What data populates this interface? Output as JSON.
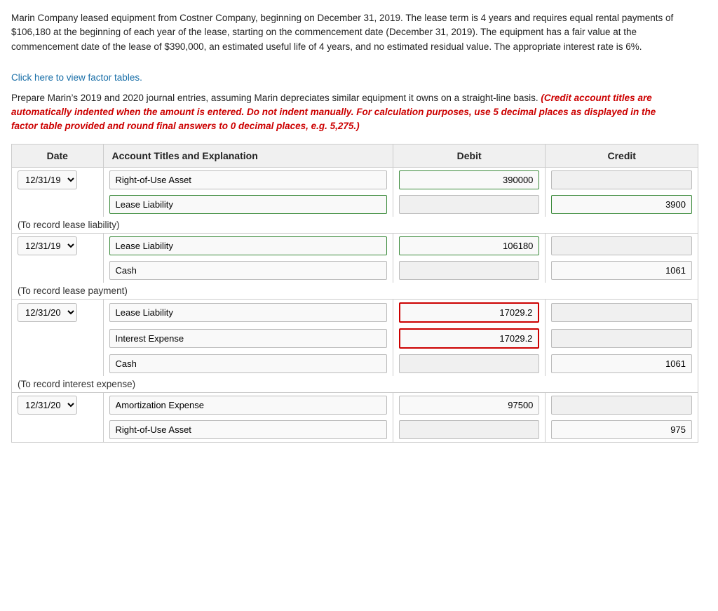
{
  "intro": {
    "text": "Marin Company leased equipment from Costner Company, beginning on December 31, 2019. The lease term is 4 years and requires equal rental payments of $106,180 at the beginning of each year of the lease, starting on the commencement date (December 31, 2019). The equipment has a fair value at the commencement date of the lease of $390,000, an estimated useful life of 4 years, and no estimated residual value. The appropriate interest rate is 6%.",
    "link": "Click here to view factor tables.",
    "prepare_prefix": "Prepare Marin’s 2019 and 2020 journal entries, assuming Marin depreciates similar equipment it owns on a straight-line basis.",
    "prepare_italic": "(Credit account titles are automatically indented when the amount is entered. Do not indent manually. For calculation purposes, use 5 decimal places as displayed in the factor table provided and round final answers to 0 decimal places, e.g. 5,275.)"
  },
  "table": {
    "headers": {
      "date": "Date",
      "account": "Account Titles and Explanation",
      "debit": "Debit",
      "credit": "Credit"
    },
    "sections": [
      {
        "id": "section1",
        "date": "12/31/19",
        "rows": [
          {
            "account": "Right-of-Use Asset",
            "debit": "390000",
            "credit": "",
            "account_style": "normal",
            "debit_style": "green-border",
            "credit_style": "empty"
          },
          {
            "account": "Lease Liability",
            "debit": "",
            "credit": "3900",
            "account_style": "green-border",
            "debit_style": "empty",
            "credit_style": "green-border",
            "credit_overflow": true
          }
        ],
        "note": "(To record lease liability)"
      },
      {
        "id": "section2",
        "date": "12/31/19",
        "rows": [
          {
            "account": "Lease Liability",
            "debit": "106180",
            "credit": "",
            "account_style": "green-border",
            "debit_style": "green-border",
            "credit_style": "empty"
          },
          {
            "account": "Cash",
            "debit": "",
            "credit": "1061",
            "account_style": "normal",
            "debit_style": "empty",
            "credit_style": "normal",
            "credit_overflow": true
          }
        ],
        "note": "(To record lease payment)"
      },
      {
        "id": "section3",
        "date": "12/31/20",
        "rows": [
          {
            "account": "Lease Liability",
            "debit": "17029.2",
            "credit": "",
            "account_style": "normal",
            "debit_style": "red-border",
            "credit_style": "empty"
          },
          {
            "account": "Interest Expense",
            "debit": "17029.2",
            "credit": "",
            "account_style": "normal",
            "debit_style": "red-border",
            "credit_style": "empty"
          },
          {
            "account": "Cash",
            "debit": "",
            "credit": "1061",
            "account_style": "normal",
            "debit_style": "empty",
            "credit_style": "normal",
            "credit_overflow": true
          }
        ],
        "note": "(To record interest expense)"
      },
      {
        "id": "section4",
        "date": "12/31/20",
        "rows": [
          {
            "account": "Amortization Expense",
            "debit": "97500",
            "credit": "",
            "account_style": "normal",
            "debit_style": "normal",
            "credit_style": "empty"
          },
          {
            "account": "Right-of-Use Asset",
            "debit": "",
            "credit": "975",
            "account_style": "normal",
            "debit_style": "empty",
            "credit_style": "normal",
            "credit_overflow": true
          }
        ],
        "note": ""
      }
    ]
  }
}
